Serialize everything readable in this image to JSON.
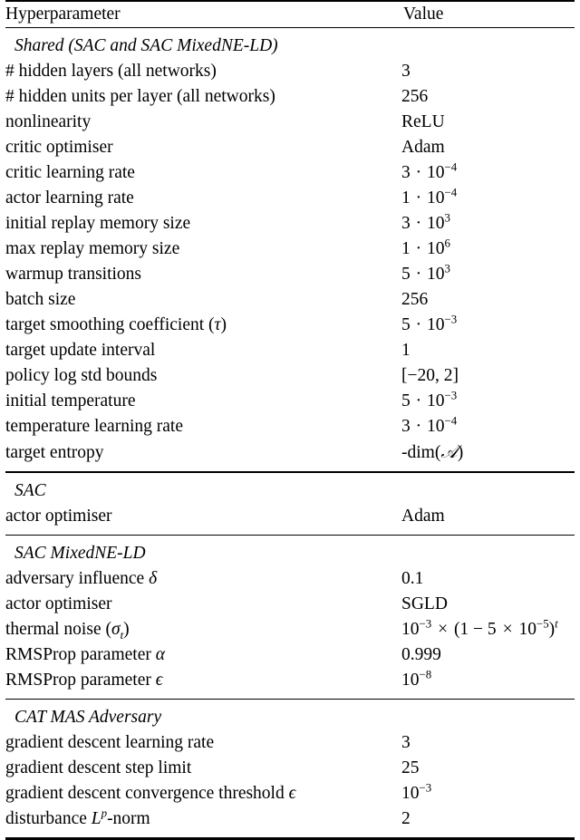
{
  "table": {
    "columns": {
      "name_header": "Hyperparameter",
      "value_header": "Value"
    },
    "sections": [
      {
        "title": "Shared (SAC and SAC MixedNE-LD)",
        "rows": [
          {
            "name": "# hidden layers (all networks)",
            "value": "3"
          },
          {
            "name": "# hidden units per layer (all networks)",
            "value": "256"
          },
          {
            "name": "nonlinearity",
            "value": "ReLU"
          },
          {
            "name": "critic optimiser",
            "value": "Adam"
          },
          {
            "name": "critic learning rate",
            "value": "3 · 10⁻⁴"
          },
          {
            "name": "actor learning rate",
            "value": "1 · 10⁻⁴"
          },
          {
            "name": "initial replay memory size",
            "value": "3 · 10³"
          },
          {
            "name": "max replay memory size",
            "value": "1 · 10⁶"
          },
          {
            "name": "warmup transitions",
            "value": "5 · 10³"
          },
          {
            "name": "batch size",
            "value": "256"
          },
          {
            "name": "target smoothing coefficient (τ)",
            "value": "5 · 10⁻³"
          },
          {
            "name": "target update interval",
            "value": "1"
          },
          {
            "name": "policy log std bounds",
            "value": "[−20, 2]"
          },
          {
            "name": "initial temperature",
            "value": "5 · 10⁻³"
          },
          {
            "name": "temperature learning rate",
            "value": "3 · 10⁻⁴"
          },
          {
            "name": "target entropy",
            "value": "-dim(𝒜)"
          }
        ]
      },
      {
        "title": "SAC",
        "rows": [
          {
            "name": "actor optimiser",
            "value": "Adam"
          }
        ]
      },
      {
        "title": "SAC MixedNE-LD",
        "rows": [
          {
            "name": "adversary influence δ",
            "value": "0.1"
          },
          {
            "name": "actor optimiser",
            "value": "SGLD"
          },
          {
            "name": "thermal noise (σₜ)",
            "value": "10⁻³ × (1 − 5 × 10⁻⁵)ᵗ"
          },
          {
            "name": "RMSProp parameter α",
            "value": "0.999"
          },
          {
            "name": "RMSProp parameter ϵ",
            "value": "10⁻⁸"
          }
        ]
      },
      {
        "title": "CAT MAS Adversary",
        "rows": [
          {
            "name": "gradient descent learning rate",
            "value": "3"
          },
          {
            "name": "gradient descent step limit",
            "value": "25"
          },
          {
            "name": "gradient descent convergence threshold ϵ",
            "value": "10⁻³"
          },
          {
            "name": "disturbance Lᵖ-norm",
            "value": "2"
          }
        ]
      }
    ]
  },
  "style": {
    "rule_color": "#000000",
    "text_color": "#000000",
    "background": "#ffffff"
  }
}
